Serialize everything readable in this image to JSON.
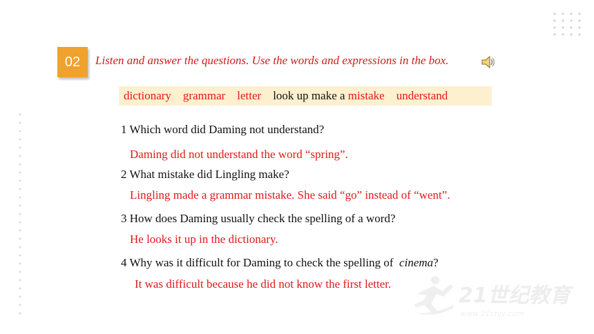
{
  "badge": "02",
  "instruction": "Listen and answer the questions. Use the words and expressions in the box.",
  "word_box": {
    "w1": "dictionary",
    "w2": "grammar",
    "w3": "letter",
    "w4": "look up make a",
    "w5": "mistake",
    "w6": "understand"
  },
  "qa": [
    {
      "q": "1 Which word did Daming not understand?",
      "a": "Daming did not understand the word “spring”."
    },
    {
      "q": "2 What mistake did Lingling make?",
      "a": "Lingling made a  grammar mistake. She said “go” instead of “went”."
    },
    {
      "q": "3 How does Daming usually check the spelling of a word?",
      "a": "He looks it up in the dictionary."
    },
    {
      "q": "4 Why was it difficult for Daming to check the spelling of",
      "q_italic": "cinema",
      "q_end": "?",
      "a": "It was difficult because he did not know the first letter."
    }
  ],
  "watermark": {
    "brand": "21世纪教育",
    "url": "www.21cnjy.com"
  },
  "colors": {
    "badge": "#f0a22e",
    "answer": "#e01818",
    "box_bg": "#fdf0cf"
  },
  "icons": {
    "speaker": "speaker-icon"
  }
}
